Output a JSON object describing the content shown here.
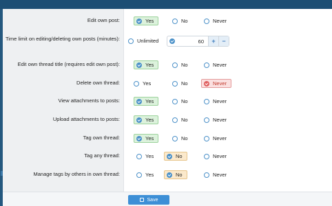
{
  "rows": [
    {
      "label": "Edit own post:",
      "options": [
        "Yes",
        "No",
        "Never"
      ],
      "selected": "Yes"
    },
    {
      "label": "Time limit on editing/deleting own posts (minutes):",
      "unlimited": "Unlimited",
      "value": "60",
      "plus": "+",
      "minus": "−"
    },
    {
      "label": "Edit own thread title (requires edit own post):",
      "options": [
        "Yes",
        "No",
        "Never"
      ],
      "selected": "Yes"
    },
    {
      "label": "Delete own thread:",
      "options": [
        "Yes",
        "No",
        "Never"
      ],
      "selected": "Never"
    },
    {
      "label": "View attachments to posts:",
      "options": [
        "Yes",
        "No",
        "Never"
      ],
      "selected": "Yes"
    },
    {
      "label": "Upload attachments to posts:",
      "options": [
        "Yes",
        "No",
        "Never"
      ],
      "selected": "Yes"
    },
    {
      "label": "Tag own thread:",
      "options": [
        "Yes",
        "No",
        "Never"
      ],
      "selected": "Yes"
    },
    {
      "label": "Tag any thread:",
      "options": [
        "Yes",
        "No",
        "Never"
      ],
      "selected": "No"
    },
    {
      "label": "Manage tags by others in own thread:",
      "options": [
        "Yes",
        "No",
        "Never"
      ],
      "selected": "No"
    }
  ],
  "footer": {
    "save_label": "Save"
  }
}
